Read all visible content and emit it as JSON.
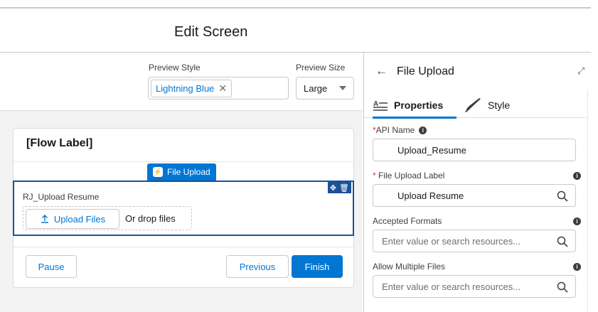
{
  "header": {
    "title": "Edit Screen"
  },
  "toolbar": {
    "preview_style_label": "Preview Style",
    "preview_style_value": "Lightning Blue",
    "preview_size_label": "Preview Size",
    "preview_size_value": "Large"
  },
  "canvas": {
    "flow_label": "[Flow Label]",
    "component_tag": "File Upload",
    "component_label": "RJ_Upload Resume",
    "upload_button": "Upload Files",
    "drop_text": "Or drop files",
    "pause_button": "Pause",
    "previous_button": "Previous",
    "finish_button": "Finish"
  },
  "panel": {
    "title": "File Upload",
    "tabs": [
      {
        "label": "Properties",
        "icon": "properties-icon",
        "active": true
      },
      {
        "label": "Style",
        "icon": "brush-icon",
        "active": false
      }
    ],
    "fields": [
      {
        "label": "API Name",
        "required": true,
        "value": "Upload_Resume",
        "placeholder": ""
      },
      {
        "label": "File Upload Label",
        "required": true,
        "value": "Upload Resume",
        "placeholder": ""
      },
      {
        "label": "Accepted Formats",
        "required": false,
        "value": "",
        "placeholder": "Enter value or search resources..."
      },
      {
        "label": "Allow Multiple Files",
        "required": false,
        "value": "",
        "placeholder": "Enter value or search resources..."
      }
    ]
  },
  "colors": {
    "brand": "#0176d3",
    "selection_border": "#1b5297",
    "required": "#c23934"
  }
}
